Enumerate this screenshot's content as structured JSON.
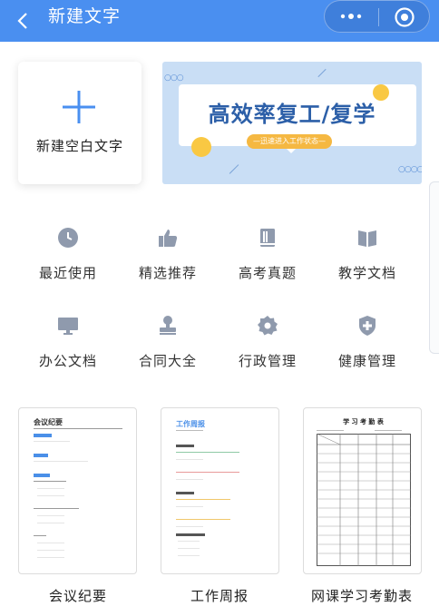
{
  "header": {
    "title": "新建文字",
    "back_icon": "chevron-left-icon",
    "more_icon": "more-dots-icon",
    "target_icon": "target-icon"
  },
  "new_blank": {
    "label": "新建空白文字"
  },
  "banner": {
    "title": "高效率复工/复学",
    "subtitle": "—迅速进入工作状态—"
  },
  "categories": [
    {
      "label": "最近使用",
      "icon": "clock-icon"
    },
    {
      "label": "精选推荐",
      "icon": "thumbs-up-icon"
    },
    {
      "label": "高考真题",
      "icon": "book-icon"
    },
    {
      "label": "教学文档",
      "icon": "open-book-icon"
    },
    {
      "label": "办公文档",
      "icon": "monitor-icon"
    },
    {
      "label": "合同大全",
      "icon": "stamp-icon"
    },
    {
      "label": "行政管理",
      "icon": "gear-icon"
    },
    {
      "label": "健康管理",
      "icon": "health-shield-icon"
    }
  ],
  "templates": [
    {
      "name": "会议纪要",
      "doc_title": "会议纪要"
    },
    {
      "name": "工作周报",
      "doc_title": "工作周报"
    },
    {
      "name": "网课学习考勤表",
      "doc_title": "学 习 考 勤 表"
    }
  ],
  "colors": {
    "primary": "#4a8ff0",
    "icon_gray": "#8f9aad",
    "accent_yellow": "#f5b842"
  }
}
